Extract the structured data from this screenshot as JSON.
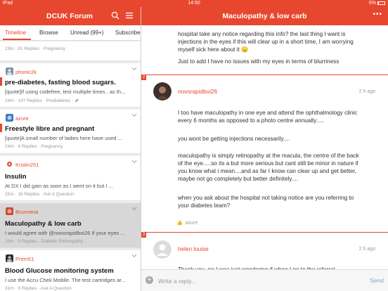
{
  "status": {
    "carrier": "iPad",
    "time": "14:50",
    "battery": "6%"
  },
  "left": {
    "title": "DCUK Forum",
    "tabs": [
      "Timeline",
      "Browse",
      "Unread (99+)",
      "Subscribed"
    ],
    "threads": [
      {
        "meta": "23m · 81 Replies · Pregnancy"
      },
      {
        "author": "phonic2k",
        "title": "pre-diabetes,  fasting blood sugars.",
        "snippet": "[quote]If using codefree, test multiple times , as th...",
        "meta": "24m · 147 Replies · Prediabetes · 🖈"
      },
      {
        "author": "azure",
        "title": "Freestyle libre and pregnant",
        "snippet": "[quote]A small number of ladies here have used ...",
        "meta": "24m · 4 Replies · Pregnancy"
      },
      {
        "author": "Kristin251",
        "title": "Insulin",
        "snippet": "At DX I did gain as soon as I went on it but I ...",
        "meta": "25m · 16 Replies · Ask A Question"
      },
      {
        "author": "Brunneria",
        "title": "Maculopathy & low carb",
        "snippet": "I would agree with @novorapidboi26   If your eyes ...",
        "meta": "29m · 9 Replies · Diabetic Retinopathy"
      },
      {
        "author": "Prem51",
        "title": "Blood Glucose monitoring system",
        "snippet": "I use the Accu Chek Mobile. The test cartridges ar...",
        "meta": "31m · 9 Replies · Ask A Question"
      }
    ]
  },
  "right": {
    "title": "Maculopathy & low carb",
    "first_post": {
      "lines": [
        "hospital take any notice regarding this info? the last thing I want is",
        "injections in the eyes if this will clear up in a short time, I am worrying",
        "myself sick here about it 😞"
      ],
      "line2": "Just to add I have no issues with my eyes in terms of blurriness"
    },
    "posts": [
      {
        "number": "2",
        "author": "novorapidboi26",
        "time": "2 h ago",
        "paragraphs": [
          [
            "I too have maculopathy in one eye and attend the ophthalmology clinic",
            "every 6 months as opposed to a photo centre annually....."
          ],
          [
            "you wont be getting injections necessarily...."
          ],
          [
            "maculopathy is simply retinopathy at the macula, the centre of the back",
            "of the eye.....so its a but more serious but cant still be minor in nature if",
            "you know what i mean....and as far I know can clear up and get better,",
            "maybe not go completely but better definitely...."
          ],
          [
            "when you ask about the hospital not taking notice are you referring to",
            "your diabetes team?"
          ]
        ],
        "like": "azure"
      },
      {
        "number": "3",
        "author": "helen louise",
        "time": "2 h ago",
        "preview": "Thank you, no I was just wondering if when I go to the referral"
      }
    ],
    "reply": {
      "placeholder": "Write a reply...",
      "send": "Send"
    }
  },
  "colors": {
    "accent": "#e8472f",
    "send": "#6fa9d6"
  }
}
